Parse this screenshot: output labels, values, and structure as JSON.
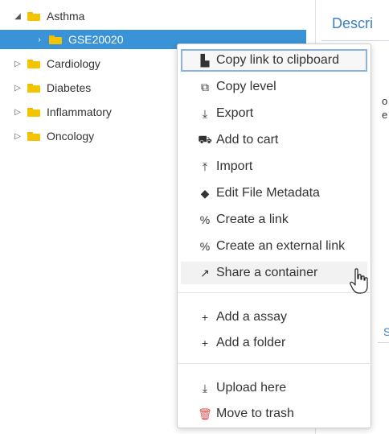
{
  "tree": {
    "items": [
      {
        "label": "Asthma",
        "toggle": "◢",
        "expanded": true
      },
      {
        "label": "GSE20020",
        "toggle": "›",
        "selected": true
      },
      {
        "label": "Cardiology",
        "toggle": "▷"
      },
      {
        "label": "Diabetes",
        "toggle": "▷"
      },
      {
        "label": "Inflammatory",
        "toggle": "▷"
      },
      {
        "label": "Oncology",
        "toggle": "▷"
      }
    ]
  },
  "right_panel": {
    "tab_label": "Descri",
    "fragment_1": "o",
    "fragment_2": "e",
    "fragment_3": "S"
  },
  "context_menu": {
    "items": [
      {
        "label": "Copy link to clipboard",
        "icon": "clipboard-icon",
        "glyph": "▙"
      },
      {
        "label": "Copy level",
        "icon": "copy-icon",
        "glyph": "⧉"
      },
      {
        "label": "Export",
        "icon": "download-icon",
        "glyph": "⤓"
      },
      {
        "label": "Add to cart",
        "icon": "cart-icon",
        "glyph": "⛟"
      },
      {
        "label": "Import",
        "icon": "upload-icon",
        "glyph": "⤒"
      },
      {
        "label": "Edit File Metadata",
        "icon": "tags-icon",
        "glyph": "◆"
      },
      {
        "label": "Create a link",
        "icon": "link-icon",
        "glyph": "%"
      },
      {
        "label": "Create an external link",
        "icon": "link-icon",
        "glyph": "%"
      },
      {
        "label": "Share a container",
        "icon": "share-icon",
        "glyph": "↗"
      },
      {
        "label": "Add a assay",
        "icon": "plus-icon",
        "glyph": "+"
      },
      {
        "label": "Add a folder",
        "icon": "plus-icon",
        "glyph": "+"
      },
      {
        "label": "Upload here",
        "icon": "upload-icon",
        "glyph": "⤓"
      },
      {
        "label": "Move to trash",
        "icon": "trash-icon",
        "glyph": "🗑"
      }
    ]
  },
  "colors": {
    "selection": "#3a93d6",
    "link": "#3a7fc4",
    "folder": "#f5c400",
    "trash": "#d9534f",
    "highlight_border": "#88b4e1"
  }
}
